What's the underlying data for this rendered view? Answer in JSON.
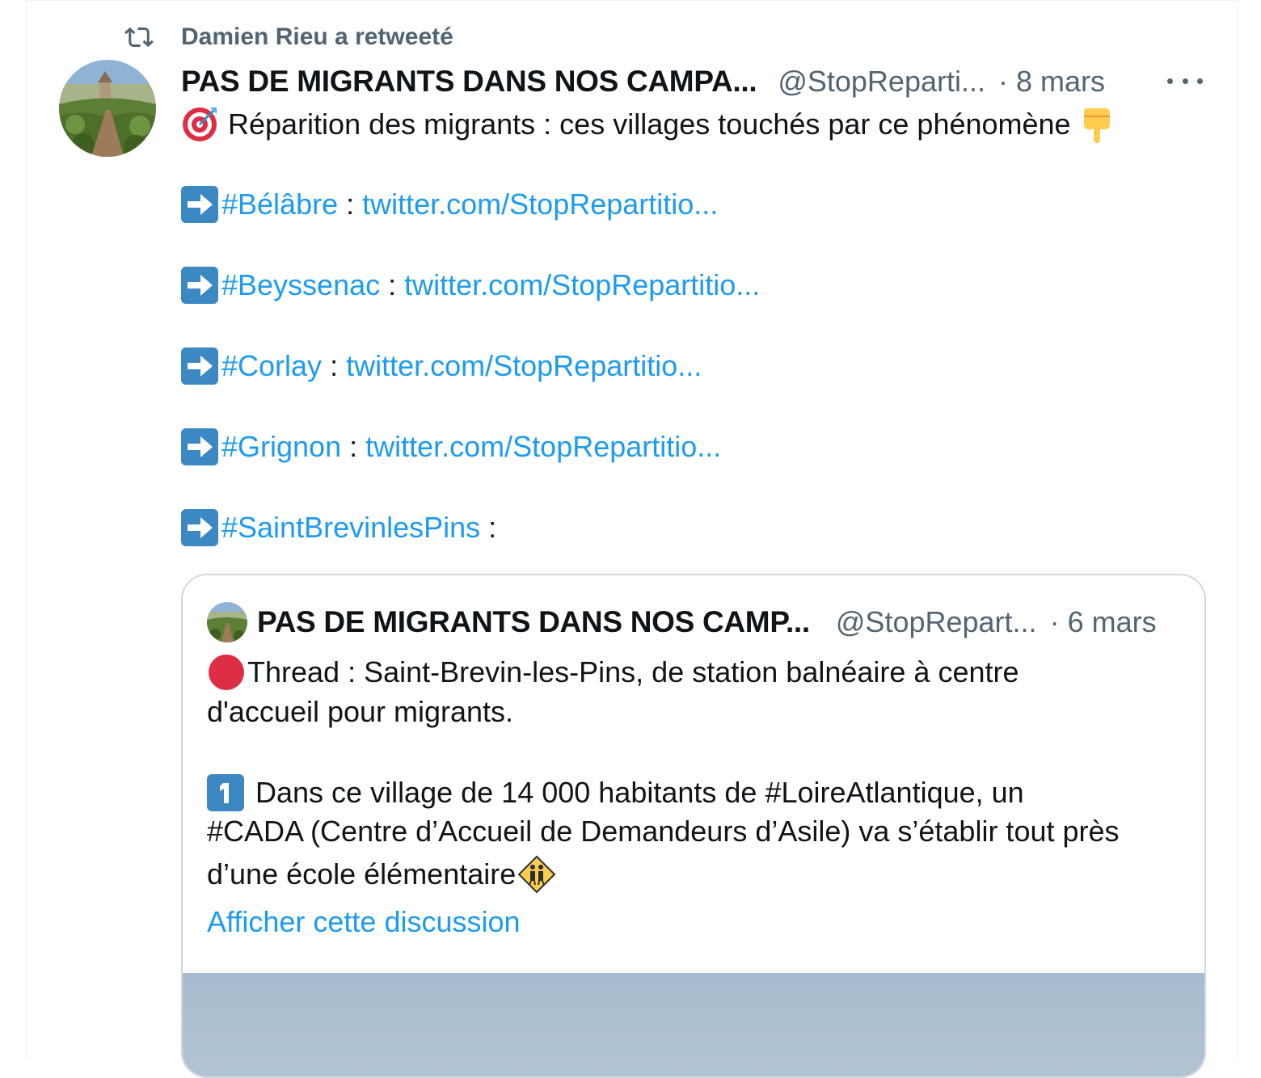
{
  "retweet": {
    "text": "Damien Rieu a retweeté",
    "icon": "retweet-icon"
  },
  "tweet": {
    "author_name": "PAS DE MIGRANTS DANS NOS CAMPA...",
    "handle": "@StopReparti...",
    "separator": "·",
    "date": "8 mars",
    "more_icon": "more-icon",
    "line1": "Réparition des migrants :  ces villages touchés par ce phénomène",
    "items": [
      {
        "hashtag": "#Bélâbre",
        "sep": " : ",
        "link": "twitter.com/StopRepartitio..."
      },
      {
        "hashtag": "#Beyssenac",
        "sep": " : ",
        "link": "twitter.com/StopRepartitio..."
      },
      {
        "hashtag": "#Corlay",
        "sep": " : ",
        "link": "twitter.com/StopRepartitio..."
      },
      {
        "hashtag": "#Grignon",
        "sep": " : ",
        "link": "twitter.com/StopRepartitio..."
      },
      {
        "hashtag": "#SaintBrevinlesPins",
        "sep": " :",
        "link": ""
      }
    ]
  },
  "quote": {
    "author_name": "PAS DE MIGRANTS DANS NOS CAMP...",
    "handle": "@StopRepart...",
    "separator": "·",
    "date": "6 mars",
    "line1": "Thread : Saint-Brevin-les-Pins, de station balnéaire à centre",
    "line2": "d'accueil pour migrants.",
    "line3": "Dans ce village de 14 000 habitants de #LoireAtlantique, un",
    "line4": "#CADA (Centre d’Accueil de Demandeurs d’Asile) va s’établir tout près",
    "line5": "d’une école élémentaire",
    "show_thread": "Afficher cette discussion"
  },
  "colors": {
    "link": "#1d9bf0",
    "muted": "#536471",
    "text": "#0f1419",
    "border": "#cfd9de"
  }
}
